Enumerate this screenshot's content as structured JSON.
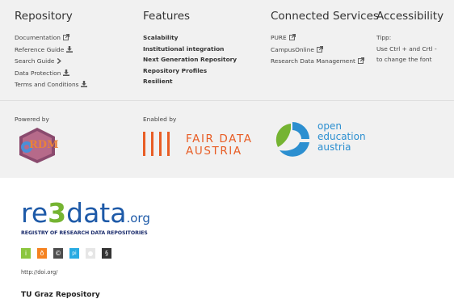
{
  "columns": {
    "repository": {
      "title": "Repository",
      "items": [
        {
          "label": "Documentation",
          "icon": "external-link-icon"
        },
        {
          "label": "Reference Guide",
          "icon": "download-icon"
        },
        {
          "label": "Search Guide",
          "icon": "chevron-right-icon"
        },
        {
          "label": "Data Protection",
          "icon": "download-icon"
        },
        {
          "label": "Terms and Conditions",
          "icon": "download-icon"
        }
      ]
    },
    "features": {
      "title": "Features",
      "items": [
        "Scalability",
        "Institutional integration",
        "Next Generation Repository",
        "Repository Profiles",
        "Resilient"
      ]
    },
    "connected": {
      "title": "Connected Services",
      "items": [
        {
          "label": "PURE",
          "icon": "external-link-icon"
        },
        {
          "label": "CampusOnline",
          "icon": "external-link-icon"
        },
        {
          "label": "Research Data Management",
          "icon": "external-link-icon"
        }
      ]
    },
    "accessibility": {
      "title": "Accessibility",
      "lines": [
        "Tipp:",
        "Use Ctrl + and Crtl -",
        "to change the font"
      ]
    }
  },
  "partners": {
    "powered_by": "Powered by",
    "enabled_by": "Enabled by",
    "invenio_logo_text": "RDM",
    "fair_line1": "FAIR DATA",
    "fair_line2": "AUSTRIA",
    "oea_line1": "open",
    "oea_line2": "education",
    "oea_line3": "austria"
  },
  "re3data": {
    "logo_re": "re",
    "logo_3": "3",
    "logo_data": "data",
    "logo_org": ".org",
    "subtitle": "REGISTRY OF RESEARCH DATA REPOSITORIES",
    "badges": [
      {
        "glyph": "i",
        "color": "#8cc63f"
      },
      {
        "glyph": "ð",
        "color": "#f58220"
      },
      {
        "glyph": "©",
        "color": "#4d4d4d"
      },
      {
        "glyph": "pi",
        "color": "#29abe2"
      },
      {
        "glyph": "",
        "color": "#e6e6e6"
      },
      {
        "glyph": "§",
        "color": "#333333"
      }
    ],
    "doi_text": "http://doi.org/"
  },
  "footer": {
    "title": "TU Graz Repository"
  },
  "colors": {
    "fair_orange": "#e85d25",
    "oea_blue": "#2c8fd0",
    "oea_green": "#75b432",
    "re3_blue": "#1e5aa8"
  }
}
